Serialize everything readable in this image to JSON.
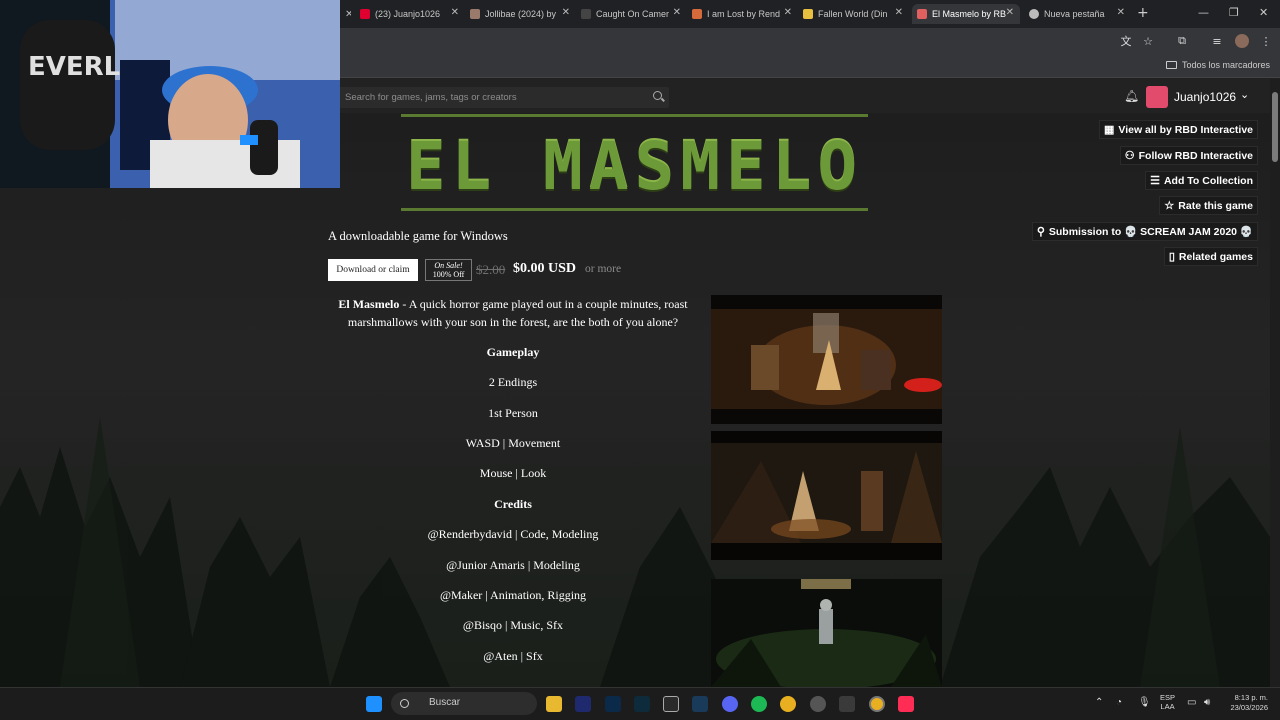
{
  "browser": {
    "tabs": [
      {
        "label": "(23) Juanjo1026",
        "color": "#e00030"
      },
      {
        "label": "Jollibae (2024) by",
        "color": "#9a7a6a"
      },
      {
        "label": "Caught On Camer",
        "color": "#444444"
      },
      {
        "label": "I am Lost by Rend",
        "color": "#d66a3a"
      },
      {
        "label": "Fallen World (Din",
        "color": "#e8c040"
      },
      {
        "label": "El Masmelo by RB",
        "color": "#e06060"
      },
      {
        "label": "Nueva pestaña",
        "color": "#bbbbbb"
      }
    ],
    "bookmarks_label": "Todos los marcadores"
  },
  "itch": {
    "search_placeholder": "Search for games, jams, tags or creators",
    "username": "Juanjo1026"
  },
  "game": {
    "logo_text": "EL MASMELO",
    "type_label": "A downloadable game for Windows",
    "download_button": "Download or claim",
    "sale_line1": "On Sale!",
    "sale_line2": "100% Off",
    "old_price": "$2.00",
    "new_price": "$0.00 USD",
    "or_more": "or more",
    "desc_title": "El Masmelo",
    "desc_text": " - A quick horror game played out in a couple minutes, roast marshmallows with your son in the forest, are the both of you alone?",
    "lines": [
      {
        "text": "Gameplay",
        "bold": true
      },
      {
        "text": "2 Endings",
        "bold": false
      },
      {
        "text": "1st Person",
        "bold": false
      },
      {
        "text": "WASD | Movement",
        "bold": false
      },
      {
        "text": "Mouse | Look",
        "bold": false
      },
      {
        "text": "Credits",
        "bold": true
      },
      {
        "text": "@Renderbydavid | Code, Modeling",
        "bold": false
      },
      {
        "text": "@Junior Amaris | Modeling",
        "bold": false
      },
      {
        "text": "@Maker | Animation, Rigging",
        "bold": false
      },
      {
        "text": "@Bisqo | Music, Sfx",
        "bold": false
      },
      {
        "text": "@Aten | Sfx",
        "bold": false
      }
    ]
  },
  "side_actions": [
    {
      "label": "View all by RBD Interactive",
      "icon": "store-icon",
      "glyph": "▦"
    },
    {
      "label": "Follow RBD Interactive",
      "icon": "follow-icon",
      "glyph": "👤"
    },
    {
      "label": "Add To Collection",
      "icon": "collection-icon",
      "glyph": "☰"
    },
    {
      "label": "Rate this game",
      "icon": "star-icon",
      "glyph": "☆"
    },
    {
      "label": "Submission to 💀 SCREAM JAM 2020 💀",
      "icon": "award-icon",
      "glyph": "🎖"
    },
    {
      "label": "Related games",
      "icon": "book-icon",
      "glyph": "📖"
    }
  ],
  "taskbar": {
    "search_label": "Buscar",
    "lang_line1": "ESP",
    "lang_line2": "LAA",
    "time": "8:13 p. m.",
    "date": "23/03/2026"
  }
}
